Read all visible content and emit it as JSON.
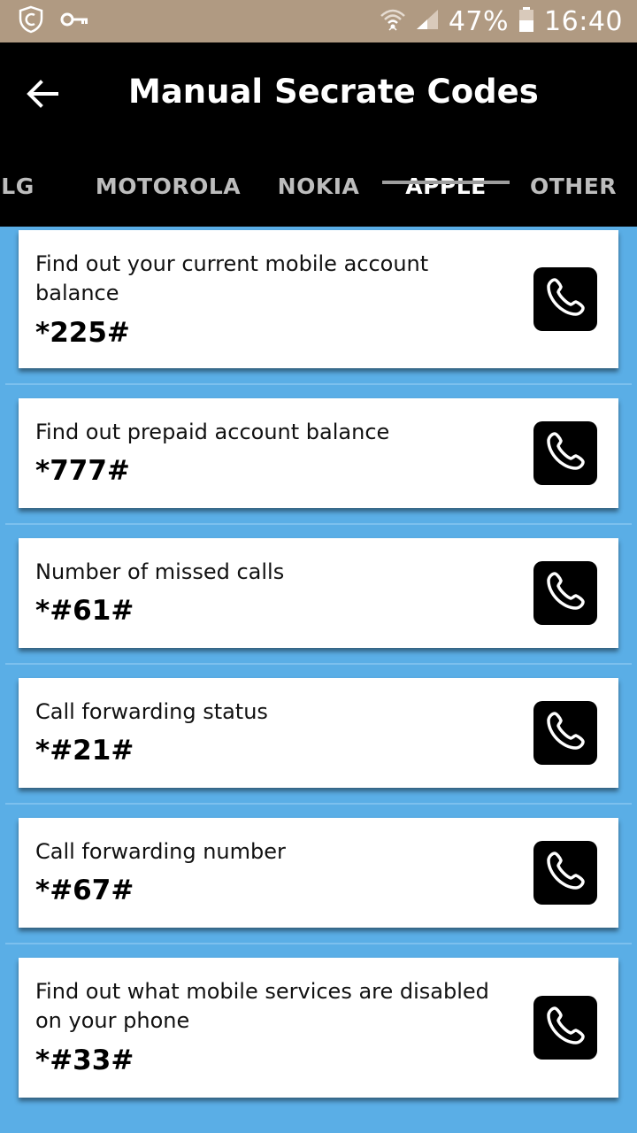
{
  "status_bar": {
    "battery": "47%",
    "time": "16:40",
    "icons": [
      "shield-icon",
      "key-icon",
      "wifi-icon",
      "signal-icon",
      "battery-icon"
    ]
  },
  "app_bar": {
    "title": "Manual Secrate Codes",
    "back_icon": "arrow-left-icon"
  },
  "tabs": [
    {
      "label": "LG",
      "active": false
    },
    {
      "label": "MOTOROLA",
      "active": false
    },
    {
      "label": "NOKIA",
      "active": false
    },
    {
      "label": "APPLE",
      "active": true
    },
    {
      "label": "OTHER",
      "active": false
    }
  ],
  "codes": [
    {
      "description": "Find out your current mobile account balance",
      "code": "*225#"
    },
    {
      "description": "Find out prepaid account balance",
      "code": "*777#"
    },
    {
      "description": "Number of missed calls",
      "code": "*#61#"
    },
    {
      "description": "Call forwarding status",
      "code": "*#21#"
    },
    {
      "description": "Call forwarding number",
      "code": "*#67#"
    },
    {
      "description": "Find out what mobile services are disabled on your phone",
      "code": "*#33#"
    }
  ],
  "colors": {
    "status_bar": "#b09a82",
    "app_bar": "#000000",
    "list_background": "#5aaee6",
    "card": "#ffffff",
    "tab_active": "#ffffff",
    "tab_inactive": "#bdbdbd"
  }
}
